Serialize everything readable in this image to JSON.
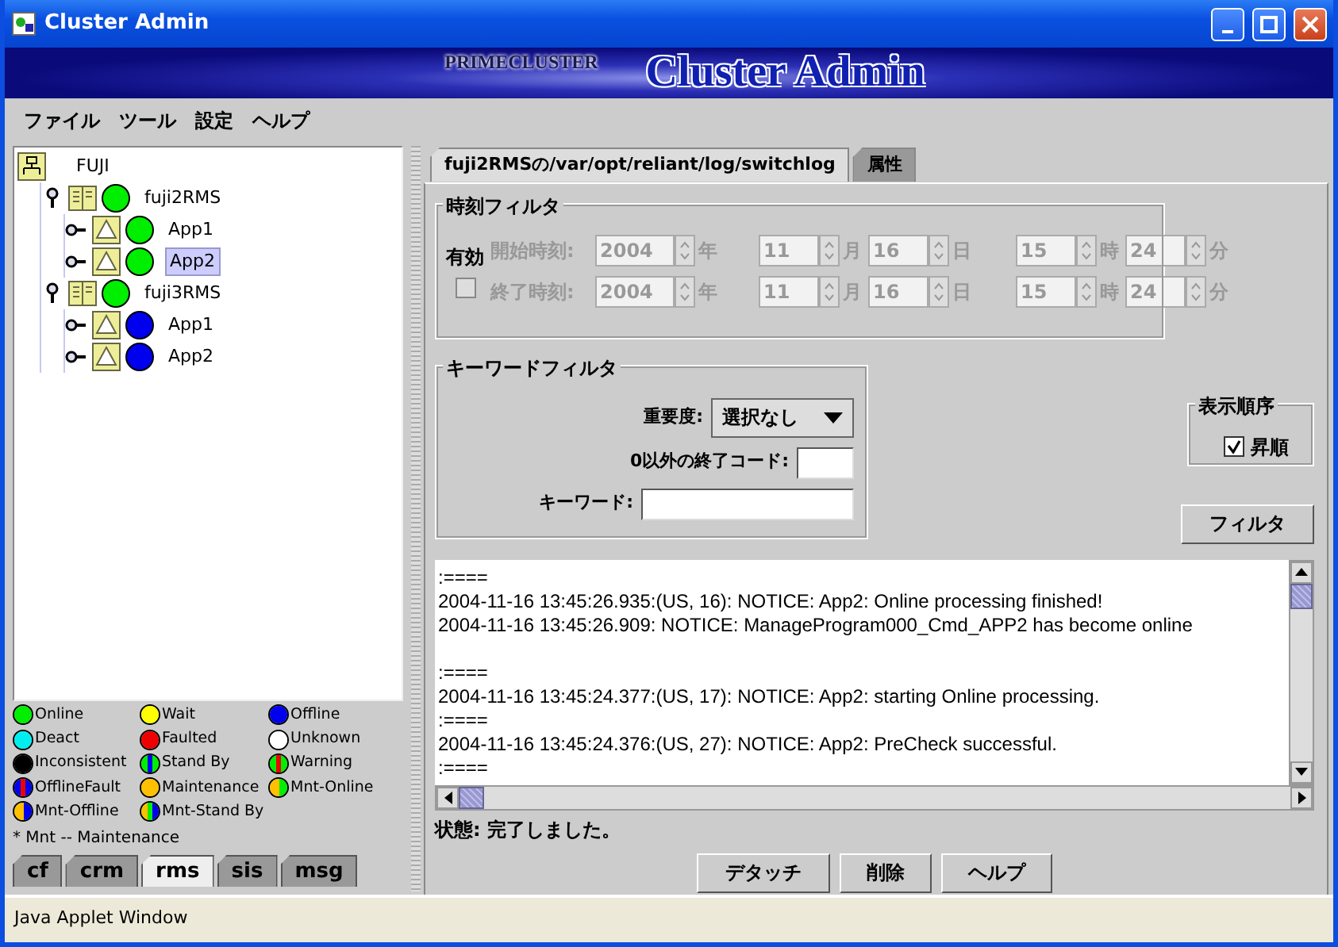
{
  "window": {
    "title": "Cluster Admin"
  },
  "banner": {
    "brand": "PRIMECLUSTER",
    "title": "Cluster Admin"
  },
  "menu": [
    "ファイル",
    "ツール",
    "設定",
    "ヘルプ"
  ],
  "tree": {
    "label": "FUJI",
    "kind": "cluster",
    "children": [
      {
        "label": "fuji2RMS",
        "kind": "host",
        "color": "#00ee00",
        "expanded": true,
        "selected": false,
        "children": [
          {
            "label": "App1",
            "kind": "app",
            "color": "#00ee00",
            "expanded": false,
            "selected": false
          },
          {
            "label": "App2",
            "kind": "app",
            "color": "#00ee00",
            "expanded": false,
            "selected": true
          }
        ]
      },
      {
        "label": "fuji3RMS",
        "kind": "host",
        "color": "#00ee00",
        "expanded": true,
        "selected": false,
        "children": [
          {
            "label": "App1",
            "kind": "app",
            "color": "#0000ee",
            "expanded": false,
            "selected": false
          },
          {
            "label": "App2",
            "kind": "app",
            "color": "#0000ee",
            "expanded": false,
            "selected": false
          }
        ]
      }
    ]
  },
  "legend": [
    {
      "label": "Online",
      "segments": [
        {
          "color": "#00ee00"
        }
      ]
    },
    {
      "label": "Wait",
      "segments": [
        {
          "color": "#ffff00"
        }
      ]
    },
    {
      "label": "Offline",
      "segments": [
        {
          "color": "#0000ee"
        }
      ]
    },
    {
      "label": "Deact",
      "segments": [
        {
          "color": "#00eeee"
        }
      ]
    },
    {
      "label": "Faulted",
      "segments": [
        {
          "color": "#ee0000"
        }
      ]
    },
    {
      "label": "Unknown",
      "segments": [
        {
          "color": "#ffffff"
        }
      ]
    },
    {
      "label": "Inconsistent",
      "segments": [
        {
          "color": "#000000"
        }
      ]
    },
    {
      "label": "Stand By",
      "segments": [
        {
          "color": "#00ee00"
        },
        {
          "color": "#0000ee"
        },
        {
          "color": "#00ee00"
        }
      ]
    },
    {
      "label": "Warning",
      "segments": [
        {
          "color": "#00ee00"
        },
        {
          "color": "#ee0000"
        },
        {
          "color": "#00ee00"
        }
      ]
    },
    {
      "label": "OfflineFault",
      "segments": [
        {
          "color": "#0000ee"
        },
        {
          "color": "#ee0000"
        },
        {
          "color": "#0000ee"
        }
      ]
    },
    {
      "label": "Maintenance",
      "segments": [
        {
          "color": "#ffc000"
        }
      ]
    },
    {
      "label": "Mnt-Online",
      "segments": [
        {
          "color": "#ffc000"
        },
        {
          "color": "#00ee00"
        }
      ]
    },
    {
      "label": "Mnt-Offline",
      "segments": [
        {
          "color": "#ffc000"
        },
        {
          "color": "#0000ee"
        }
      ]
    },
    {
      "label": "Mnt-Stand By",
      "segments": [
        {
          "color": "#ffc000"
        },
        {
          "color": "#00ee00"
        },
        {
          "color": "#0000ee"
        }
      ]
    }
  ],
  "legend_note": "* Mnt -- Maintenance",
  "left_tabs": [
    {
      "label": "cf",
      "selected": false
    },
    {
      "label": "crm",
      "selected": false
    },
    {
      "label": "rms",
      "selected": true
    },
    {
      "label": "sis",
      "selected": false
    },
    {
      "label": "msg",
      "selected": false
    }
  ],
  "tabs": [
    {
      "label": "fuji2RMSの/var/opt/reliant/log/switchlog",
      "selected": true
    },
    {
      "label": "属性",
      "selected": false
    }
  ],
  "time_filter": {
    "title": "時刻フィルタ",
    "enabled_label": "有効",
    "enabled": false,
    "rows": [
      {
        "label": "開始時刻:",
        "fields": [
          {
            "value": "2004",
            "unit": "年"
          },
          {
            "value": "11",
            "unit": "月"
          },
          {
            "value": "16",
            "unit": "日"
          },
          {
            "value": "15",
            "unit": "時"
          },
          {
            "value": "24",
            "unit": "分"
          }
        ]
      },
      {
        "label": "終了時刻:",
        "fields": [
          {
            "value": "2004",
            "unit": "年"
          },
          {
            "value": "11",
            "unit": "月"
          },
          {
            "value": "16",
            "unit": "日"
          },
          {
            "value": "15",
            "unit": "時"
          },
          {
            "value": "24",
            "unit": "分"
          }
        ]
      }
    ]
  },
  "keyword_filter": {
    "title": "キーワードフィルタ",
    "severity_label": "重要度:",
    "severity": "選択なし",
    "exit_code_label": "0以外の終了コード:",
    "keyword_label": "キーワード:"
  },
  "sort_order": {
    "title": "表示順序",
    "label": "昇順",
    "checked": true
  },
  "filter_button": "フィルタ",
  "log_lines": [
    {
      "text": ":===="
    },
    {
      "text": "2004-11-16 13:45:26.935:(US, 16): NOTICE: App2: Online processing finished!"
    },
    {
      "text": "2004-11-16 13:45:26.909: NOTICE: ManageProgram000_Cmd_APP2 has become online"
    },
    {
      "text": ":====",
      "blank_before": true
    },
    {
      "text": "2004-11-16 13:45:24.377:(US, 17): NOTICE: App2: starting Online processing."
    },
    {
      "text": ":===="
    },
    {
      "text": "2004-11-16 13:45:24.376:(US, 27): NOTICE: App2: PreCheck successful."
    },
    {
      "text": ":===="
    }
  ],
  "status": "状態: 完了しました。",
  "buttons": [
    "デタッチ",
    "削除",
    "ヘルプ"
  ],
  "status_bar": "Java Applet Window"
}
